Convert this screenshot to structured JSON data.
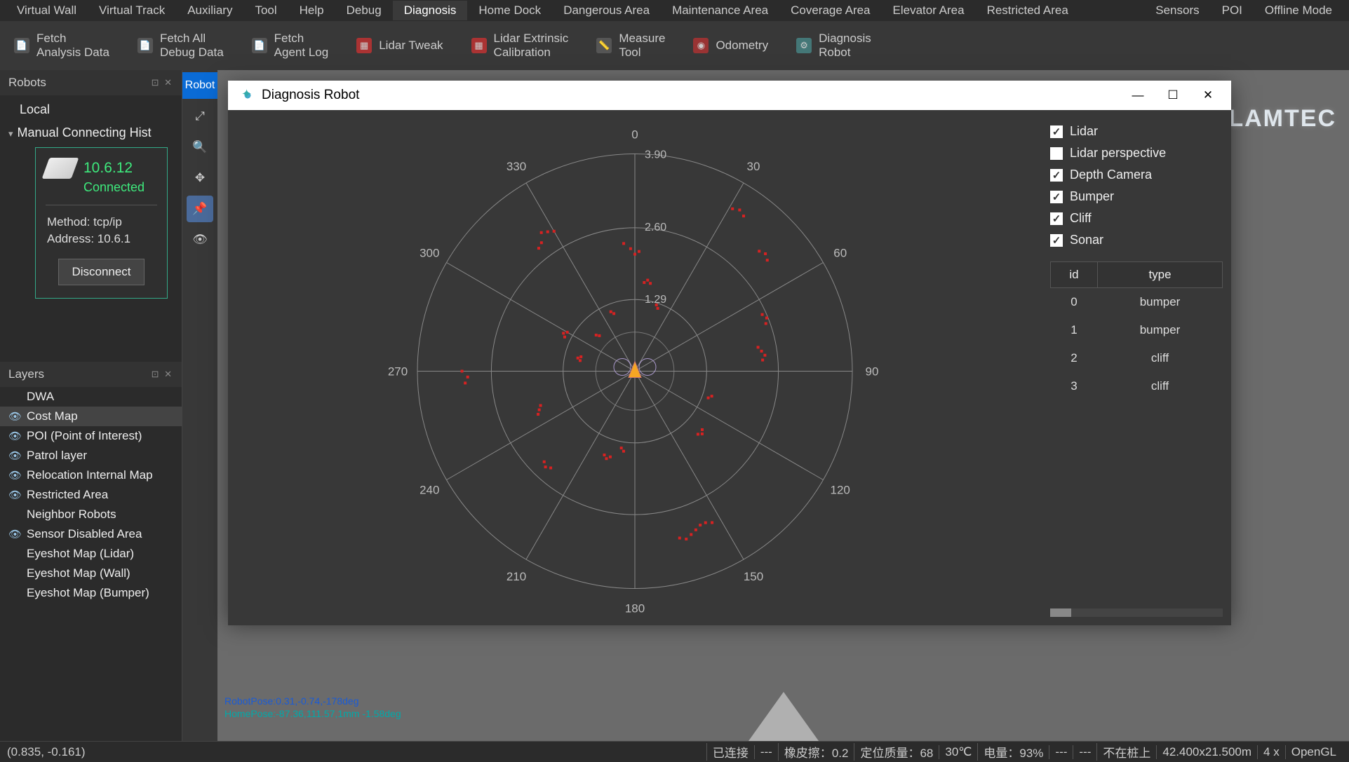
{
  "menu": {
    "items": [
      "Virtual Wall",
      "Virtual Track",
      "Auxiliary",
      "Tool",
      "Help",
      "Debug",
      "Diagnosis",
      "Home Dock",
      "Dangerous Area",
      "Maintenance Area",
      "Coverage Area",
      "Elevator Area",
      "Restricted Area"
    ],
    "right_items": [
      "Sensors",
      "POI",
      "Offline Mode"
    ],
    "active": "Diagnosis"
  },
  "toolbar": {
    "fetch_analysis": "Fetch\nAnalysis Data",
    "fetch_all_debug": "Fetch All\nDebug Data",
    "fetch_agent_log": "Fetch\nAgent Log",
    "lidar_tweak": "Lidar Tweak",
    "lidar_ext": "Lidar Extrinsic\nCalibration",
    "measure": "Measure\nTool",
    "odometry": "Odometry",
    "diag_robot": "Diagnosis\nRobot"
  },
  "robots_panel": {
    "title": "Robots",
    "local": "Local",
    "history_label": "Manual Connecting Hist",
    "card": {
      "ip": "10.6.12",
      "status": "Connected",
      "method": "Method: tcp/ip",
      "address": "Address: 10.6.1",
      "disconnect": "Disconnect"
    }
  },
  "tooltray": {
    "first_label": "Robot"
  },
  "layers_panel": {
    "title": "Layers",
    "items": [
      {
        "eye": false,
        "label": "DWA"
      },
      {
        "eye": true,
        "label": "Cost Map",
        "sel": true
      },
      {
        "eye": true,
        "label": "POI (Point of Interest)"
      },
      {
        "eye": true,
        "label": "Patrol layer"
      },
      {
        "eye": true,
        "label": "Relocation Internal Map"
      },
      {
        "eye": true,
        "label": "Restricted Area"
      },
      {
        "eye": false,
        "label": "Neighbor Robots"
      },
      {
        "eye": true,
        "label": "Sensor Disabled Area"
      },
      {
        "eye": false,
        "label": "Eyeshot Map (Lidar)"
      },
      {
        "eye": false,
        "label": "Eyeshot Map (Wall)"
      },
      {
        "eye": false,
        "label": "Eyeshot Map (Bumper)"
      }
    ]
  },
  "dialog": {
    "title": "Diagnosis Robot",
    "checks": [
      {
        "label": "Lidar",
        "on": true
      },
      {
        "label": "Lidar perspective",
        "on": false
      },
      {
        "label": "Depth Camera",
        "on": true
      },
      {
        "label": "Bumper",
        "on": true
      },
      {
        "label": "Cliff",
        "on": true
      },
      {
        "label": "Sonar",
        "on": true
      }
    ],
    "table": {
      "headers": [
        "id",
        "type"
      ],
      "rows": [
        {
          "id": "0",
          "type": "bumper"
        },
        {
          "id": "1",
          "type": "bumper"
        },
        {
          "id": "2",
          "type": "cliff"
        },
        {
          "id": "3",
          "type": "cliff"
        }
      ]
    }
  },
  "chart_data": {
    "type": "polar-scatter",
    "title": "Diagnosis Robot",
    "center_label_top": "0",
    "angle_ticks": [
      0,
      30,
      60,
      90,
      120,
      150,
      180,
      210,
      240,
      270,
      300,
      330
    ],
    "radius_ticks": [
      1.29,
      2.6,
      3.9
    ],
    "angle_range": [
      0,
      360
    ],
    "radius_range": [
      0,
      3.9
    ],
    "series": [
      {
        "name": "Lidar",
        "color": "#d62222",
        "points": [
          {
            "a": 0,
            "r": 2.1
          },
          {
            "a": 2,
            "r": 2.15
          },
          {
            "a": 358,
            "r": 2.2
          },
          {
            "a": 355,
            "r": 2.3
          },
          {
            "a": 330,
            "r": 2.9
          },
          {
            "a": 328,
            "r": 2.95
          },
          {
            "a": 326,
            "r": 3.0
          },
          {
            "a": 324,
            "r": 2.85
          },
          {
            "a": 322,
            "r": 2.8
          },
          {
            "a": 300,
            "r": 1.4
          },
          {
            "a": 298,
            "r": 1.45
          },
          {
            "a": 296,
            "r": 1.4
          },
          {
            "a": 285,
            "r": 1.0
          },
          {
            "a": 283,
            "r": 1.05
          },
          {
            "a": 281,
            "r": 1.0
          },
          {
            "a": 270,
            "r": 3.1
          },
          {
            "a": 268,
            "r": 3.0
          },
          {
            "a": 266,
            "r": 3.05
          },
          {
            "a": 250,
            "r": 1.8
          },
          {
            "a": 248,
            "r": 1.85
          },
          {
            "a": 246,
            "r": 1.9
          },
          {
            "a": 225,
            "r": 2.3
          },
          {
            "a": 223,
            "r": 2.35
          },
          {
            "a": 221,
            "r": 2.3
          },
          {
            "a": 200,
            "r": 1.6
          },
          {
            "a": 198,
            "r": 1.65
          },
          {
            "a": 196,
            "r": 1.6
          },
          {
            "a": 190,
            "r": 1.4
          },
          {
            "a": 188,
            "r": 1.45
          },
          {
            "a": 165,
            "r": 3.1
          },
          {
            "a": 163,
            "r": 3.15
          },
          {
            "a": 161,
            "r": 3.1
          },
          {
            "a": 159,
            "r": 3.05
          },
          {
            "a": 157,
            "r": 3.0
          },
          {
            "a": 155,
            "r": 3.0
          },
          {
            "a": 153,
            "r": 3.05
          },
          {
            "a": 135,
            "r": 1.6
          },
          {
            "a": 133,
            "r": 1.65
          },
          {
            "a": 131,
            "r": 1.6
          },
          {
            "a": 110,
            "r": 1.4
          },
          {
            "a": 108,
            "r": 1.45
          },
          {
            "a": 85,
            "r": 2.3
          },
          {
            "a": 83,
            "r": 2.35
          },
          {
            "a": 81,
            "r": 2.3
          },
          {
            "a": 79,
            "r": 2.25
          },
          {
            "a": 70,
            "r": 2.5
          },
          {
            "a": 68,
            "r": 2.55
          },
          {
            "a": 66,
            "r": 2.5
          },
          {
            "a": 50,
            "r": 3.1
          },
          {
            "a": 48,
            "r": 3.15
          },
          {
            "a": 46,
            "r": 3.1
          },
          {
            "a": 35,
            "r": 3.4
          },
          {
            "a": 33,
            "r": 3.45
          },
          {
            "a": 31,
            "r": 3.4
          },
          {
            "a": 20,
            "r": 1.2
          },
          {
            "a": 18,
            "r": 1.25
          },
          {
            "a": 10,
            "r": 1.6
          },
          {
            "a": 8,
            "r": 1.65
          },
          {
            "a": 6,
            "r": 1.6
          },
          {
            "a": 340,
            "r": 1.1
          },
          {
            "a": 338,
            "r": 1.15
          },
          {
            "a": 315,
            "r": 0.9
          },
          {
            "a": 313,
            "r": 0.95
          }
        ]
      }
    ]
  },
  "brand": "SLAMTEC",
  "mapfoot": {
    "l1": "RobotPose:0.31,-0.74,-178deg",
    "l2": "HomePose:-87.36,111.57,1mm -1.58deg"
  },
  "status": {
    "coord": "(0.835, -0.161)",
    "connected": "已连接",
    "sep1": "---",
    "rubber": "橡皮擦：",
    "rubber_val": "0.2",
    "loc_q": "定位质量：",
    "loc_q_val": "68",
    "temp": "30℃",
    "power": "电量：",
    "power_val": "93%",
    "sep2": "---",
    "sep3": "---",
    "dock": "不在桩上",
    "mapsize": "42.400x21.500m",
    "zoom": "4 x",
    "renderer": "OpenGL"
  }
}
